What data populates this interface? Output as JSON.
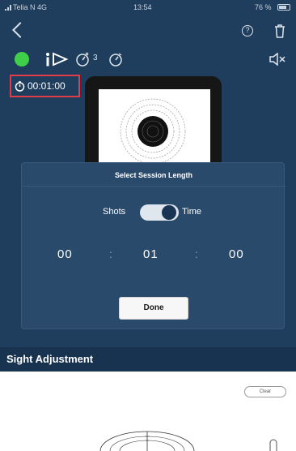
{
  "status_bar": {
    "carrier": "Telia N 4G",
    "time": "13:54",
    "battery_text": "76 %"
  },
  "toolbar": {
    "status_color": "#3fcf48",
    "shot_count": "3"
  },
  "timer": {
    "value": "00:01:00",
    "highlight_color": "#e23c4a"
  },
  "modal": {
    "title": "Select Session Length",
    "mode_left": "Shots",
    "mode_right": "Time",
    "mode_selected": "Time",
    "hours": "00",
    "minutes": "01",
    "seconds": "00",
    "separator": ":",
    "done_label": "Done"
  },
  "section": {
    "title": "Sight Adjustment",
    "clear_label": "Clear"
  },
  "colors": {
    "background": "#1f3d5c",
    "modal": "#2a4a6b",
    "header": "#173350"
  }
}
